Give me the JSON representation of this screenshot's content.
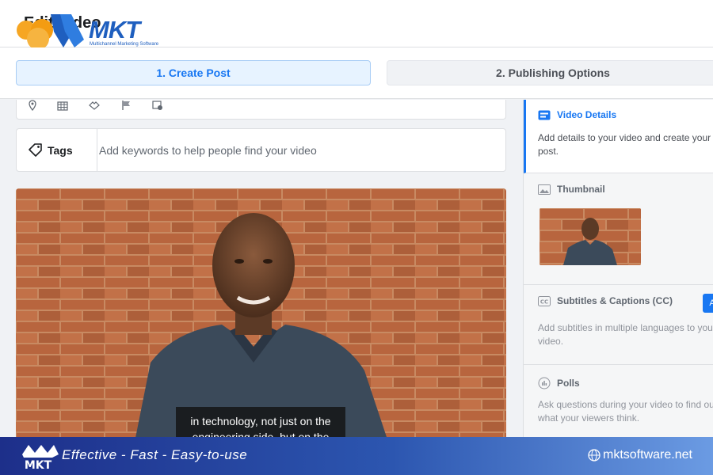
{
  "header": {
    "title": "Edit Video",
    "logo_text": "MKT",
    "logo_subtitle": "Multichannel Marketing Software"
  },
  "steps": [
    {
      "label": "1. Create Post",
      "active": true
    },
    {
      "label": "2. Publishing Options",
      "active": false
    }
  ],
  "toolbar_icons": [
    "location-icon",
    "calendar-icon",
    "handshake-icon",
    "flag-icon",
    "schedule-icon"
  ],
  "tags": {
    "label": "Tags",
    "placeholder": "Add keywords to help people find your video"
  },
  "video": {
    "caption_line1": "in technology, not just on the",
    "caption_line2": "engineering side, but on the"
  },
  "sidebar": {
    "video_details": {
      "title": "Video Details",
      "description": "Add details to your video and create your post."
    },
    "thumbnail": {
      "title": "Thumbnail"
    },
    "subtitles": {
      "title": "Subtitles & Captions (CC)",
      "description": "Add subtitles in multiple languages to your video.",
      "button_label": "A"
    },
    "polls": {
      "title": "Polls",
      "description": "Ask questions during your video to find out what your viewers think."
    }
  },
  "banner": {
    "logo_text": "MKT",
    "tagline": "Effective - Fast - Easy-to-use",
    "website": "mktsoftware.net"
  },
  "colors": {
    "accent": "#1877f2",
    "banner_start": "#1d2f8a",
    "banner_end": "#6b9be3"
  }
}
